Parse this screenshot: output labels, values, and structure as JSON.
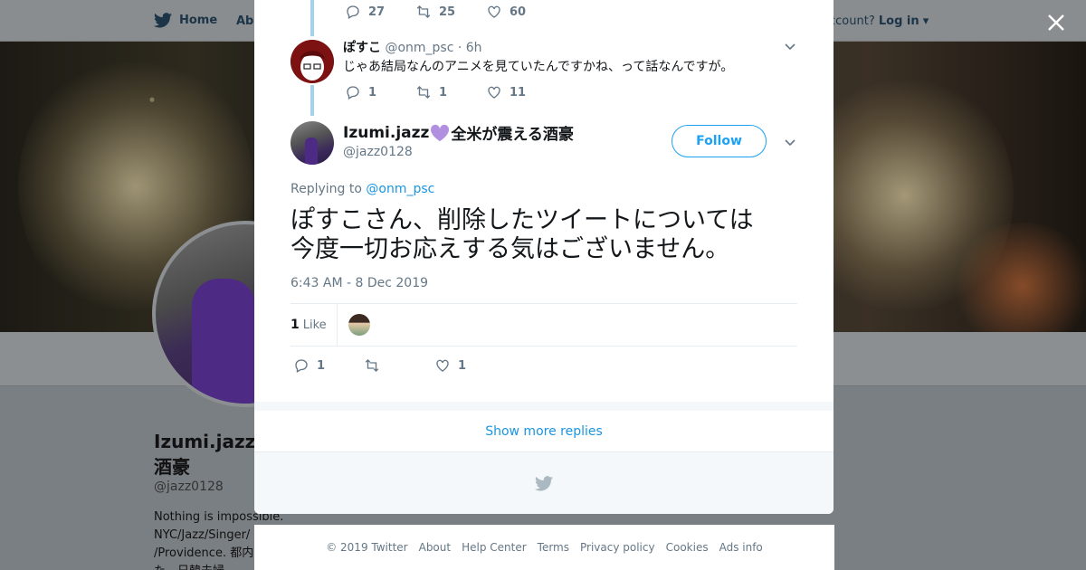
{
  "nav": {
    "home_label": "Home",
    "about_label": "Abo",
    "account_prompt": "ccount?",
    "login_label": "Log in"
  },
  "profile_bg": {
    "name": "Izumi.jazz",
    "name_line2": "酒豪",
    "handle": "@jazz0128",
    "bio_lines": [
      "Nothing is impossible.",
      "NYC/Jazz/Singer/",
      "/Providence. 都内",
      "た。日韓夫婦。"
    ]
  },
  "prev_tweet": {
    "reply_count": "27",
    "retweet_count": "25",
    "like_count": "60"
  },
  "reply_tweet": {
    "name": "ぽすこ",
    "handle": "@onm_psc",
    "time": "· 6h",
    "text": "じゃあ結局なんのアニメを見ていたんですかね、って話なんですが。",
    "reply_count": "1",
    "retweet_count": "1",
    "like_count": "11"
  },
  "main_tweet": {
    "name": "Izumi.jazz",
    "name_suffix": "全米が震える酒豪",
    "handle": "@jazz0128",
    "follow_label": "Follow",
    "replying_prefix": "Replying to",
    "replying_handle": "@onm_psc",
    "text_line1": "ぽすこさん、削除したツイートについては",
    "text_line2": "今度一切お応えする気はございません。",
    "timestamp": "6:43 AM - 8 Dec 2019",
    "likes_count": "1",
    "likes_label": "Like",
    "reply_count": "1",
    "retweet_count": "",
    "like_count": "1"
  },
  "show_more_label": "Show more replies",
  "footer": {
    "links": [
      "© 2019 Twitter",
      "About",
      "Help Center",
      "Terms",
      "Privacy policy",
      "Cookies",
      "Ads info"
    ]
  },
  "colors": {
    "accent": "#1da1f2",
    "heart_emoji": "#b190e0",
    "thread_line": "#a3d2f0"
  }
}
